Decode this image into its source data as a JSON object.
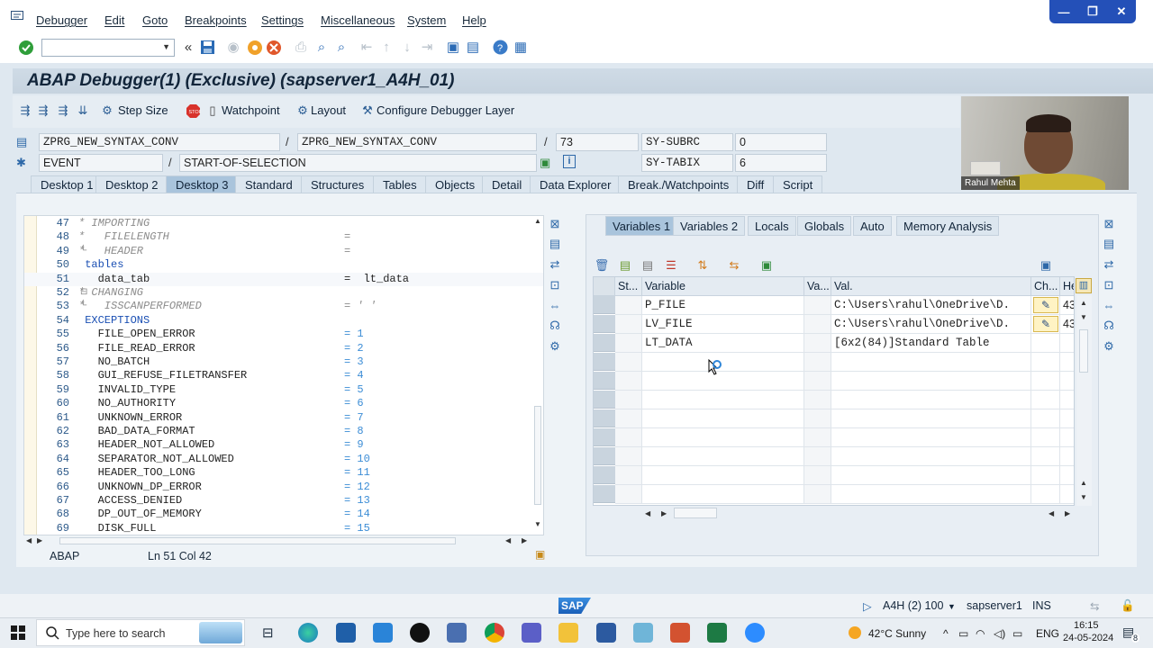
{
  "menu": [
    "Debugger",
    "Edit",
    "Goto",
    "Breakpoints",
    "Settings",
    "Miscellaneous",
    "System",
    "Help"
  ],
  "window_controls": [
    "—",
    "❐",
    "✕"
  ],
  "title": "ABAP Debugger(1)  (Exclusive) (sapserver1_A4H_01)",
  "app_toolbar": {
    "step_size": "Step Size",
    "watchpoint": "Watchpoint",
    "layout": "Layout",
    "configure": "Configure Debugger Layer"
  },
  "fields": {
    "program1": "ZPRG_NEW_SYNTAX_CONV",
    "program2": "ZPRG_NEW_SYNTAX_CONV",
    "line_no": "73",
    "sy_subrc_label": "SY-SUBRC",
    "sy_subrc_value": "0",
    "event_label": "EVENT",
    "event_value": "START-OF-SELECTION",
    "sy_tabix_label": "SY-TABIX",
    "sy_tabix_value": "6",
    "slash": "/"
  },
  "desktop_tabs": [
    "Desktop 1",
    "Desktop 2",
    "Desktop 3",
    "Standard",
    "Structures",
    "Tables",
    "Objects",
    "Detail",
    "Data Explorer",
    "Break./Watchpoints",
    "Diff",
    "Script"
  ],
  "code_lines": [
    {
      "n": "47",
      "t": "* IMPORTING",
      "v": ""
    },
    {
      "n": "48",
      "t": "*   FILELENGTH",
      "v": "="
    },
    {
      "n": "49",
      "t": "*   HEADER",
      "v": "="
    },
    {
      "n": "50",
      "t": " tables",
      "v": ""
    },
    {
      "n": "51",
      "t": "   data_tab",
      "v": "=  lt_data"
    },
    {
      "n": "52",
      "t": "* CHANGING",
      "v": ""
    },
    {
      "n": "53",
      "t": "*   ISSCANPERFORMED",
      "v": "= ' '"
    },
    {
      "n": "54",
      "t": " EXCEPTIONS",
      "v": ""
    },
    {
      "n": "55",
      "t": "   FILE_OPEN_ERROR",
      "v": "= 1"
    },
    {
      "n": "56",
      "t": "   FILE_READ_ERROR",
      "v": "= 2"
    },
    {
      "n": "57",
      "t": "   NO_BATCH",
      "v": "= 3"
    },
    {
      "n": "58",
      "t": "   GUI_REFUSE_FILETRANSFER",
      "v": "= 4"
    },
    {
      "n": "59",
      "t": "   INVALID_TYPE",
      "v": "= 5"
    },
    {
      "n": "60",
      "t": "   NO_AUTHORITY",
      "v": "= 6"
    },
    {
      "n": "61",
      "t": "   UNKNOWN_ERROR",
      "v": "= 7"
    },
    {
      "n": "62",
      "t": "   BAD_DATA_FORMAT",
      "v": "= 8"
    },
    {
      "n": "63",
      "t": "   HEADER_NOT_ALLOWED",
      "v": "= 9"
    },
    {
      "n": "64",
      "t": "   SEPARATOR_NOT_ALLOWED",
      "v": "= 10"
    },
    {
      "n": "65",
      "t": "   HEADER_TOO_LONG",
      "v": "= 11"
    },
    {
      "n": "66",
      "t": "   UNKNOWN_DP_ERROR",
      "v": "= 12"
    },
    {
      "n": "67",
      "t": "   ACCESS_DENIED",
      "v": "= 13"
    },
    {
      "n": "68",
      "t": "   DP_OUT_OF_MEMORY",
      "v": "= 14"
    },
    {
      "n": "69",
      "t": "   DISK_FULL",
      "v": "= 15"
    }
  ],
  "editor_status": {
    "lang": "ABAP",
    "pos": "Ln  51 Col  42"
  },
  "var_tabs": [
    "Variables 1",
    "Variables 2",
    "Locals",
    "Globals",
    "Auto",
    "Memory Analysis"
  ],
  "grid": {
    "headers": [
      "St...",
      "Variable",
      "Va...",
      "Val.",
      "Ch...",
      "He"
    ],
    "rows": [
      {
        "variable": "P_FILE",
        "value": "C:\\Users\\rahul\\OneDrive\\D.",
        "hex": "43"
      },
      {
        "variable": "LV_FILE",
        "value": "C:\\Users\\rahul\\OneDrive\\D.",
        "hex": "43"
      },
      {
        "variable": "LT_DATA",
        "value": "[6x2(84)]Standard Table",
        "hex": ""
      }
    ]
  },
  "webcam_name": "Rahul Mehta",
  "sap_status": {
    "logo": "SAP",
    "session": "A4H (2) 100",
    "server": "sapserver1",
    "mode": "INS"
  },
  "taskbar": {
    "search_placeholder": "Type here to search",
    "weather": "42°C  Sunny",
    "lang": "ENG",
    "time": "16:15",
    "date": "24-05-2024",
    "notif_count": "8"
  },
  "colors": {
    "active_tab": "#a9c4dc",
    "title_bg": "#cfdbe6",
    "panel_bg": "#eef3f7"
  }
}
